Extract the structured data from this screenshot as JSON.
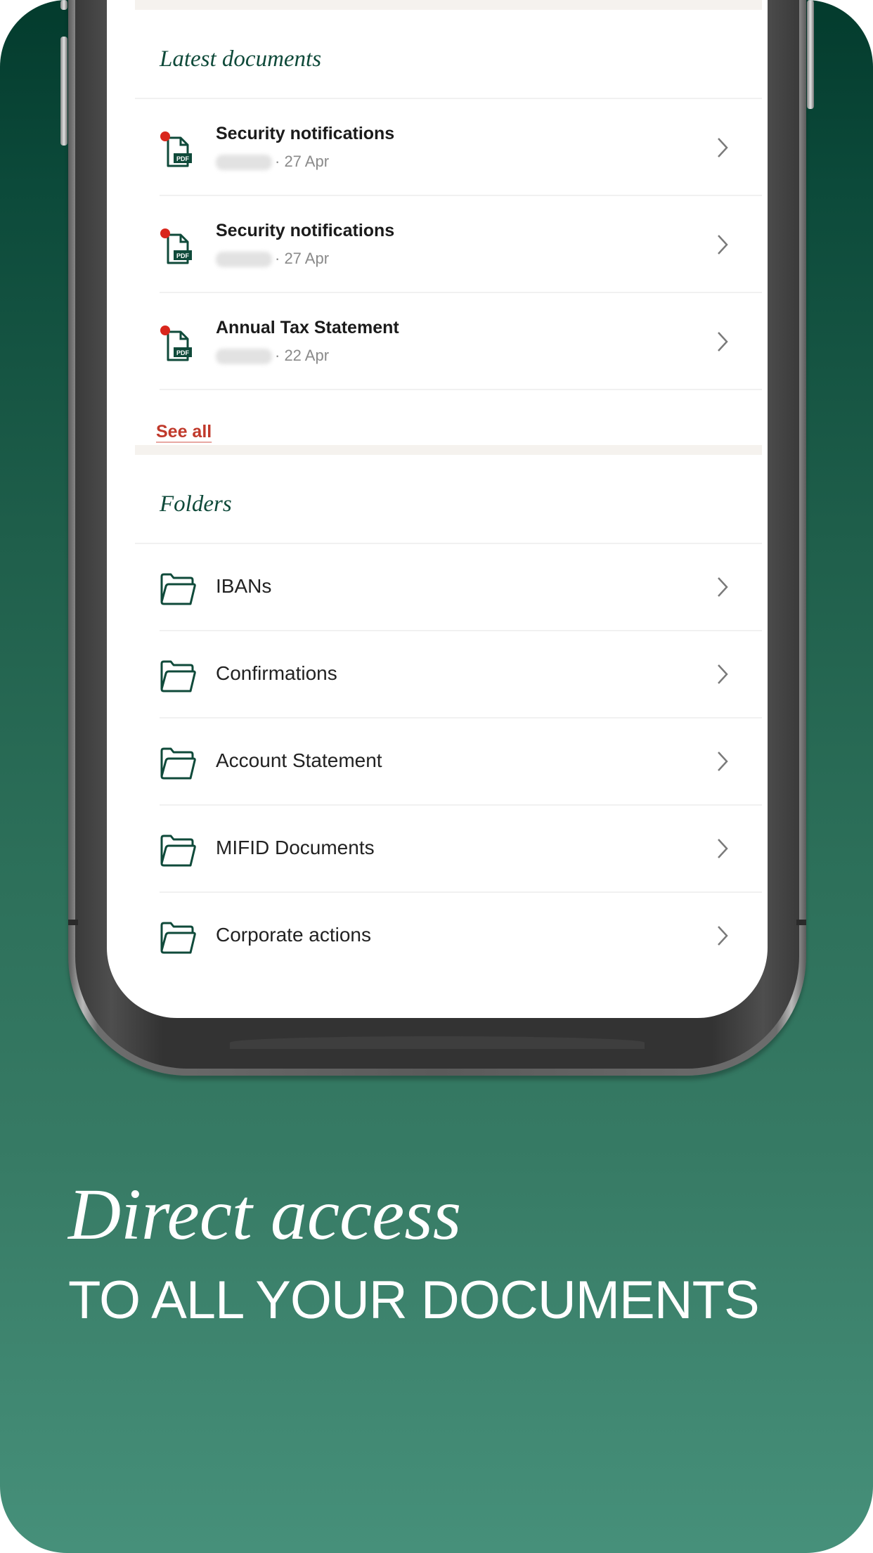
{
  "latest_documents": {
    "title": "Latest documents",
    "items": [
      {
        "title": "Security notifications",
        "meta": "· 27 Apr",
        "unread": true,
        "icon": "pdf-file-icon"
      },
      {
        "title": "Security notifications",
        "meta": "· 27 Apr",
        "unread": true,
        "icon": "pdf-file-icon"
      },
      {
        "title": "Annual Tax Statement",
        "meta": "· 22 Apr",
        "unread": true,
        "icon": "pdf-file-icon"
      }
    ],
    "see_all_label": "See all"
  },
  "folders": {
    "title": "Folders",
    "items": [
      {
        "label": "IBANs",
        "icon": "folder-icon"
      },
      {
        "label": "Confirmations",
        "icon": "folder-icon"
      },
      {
        "label": "Account Statement",
        "icon": "folder-icon"
      },
      {
        "label": "MIFID Documents",
        "icon": "folder-icon"
      },
      {
        "label": "Corporate actions",
        "icon": "folder-icon"
      }
    ]
  },
  "promo": {
    "headline": "Direct access",
    "subline": "TO ALL YOUR DOCUMENTS"
  },
  "colors": {
    "brand_green": "#0f4a3a",
    "accent_red": "#c0392b",
    "unread_dot": "#d9261c",
    "background_top": "#033b2d",
    "background_bottom": "#46907a"
  }
}
